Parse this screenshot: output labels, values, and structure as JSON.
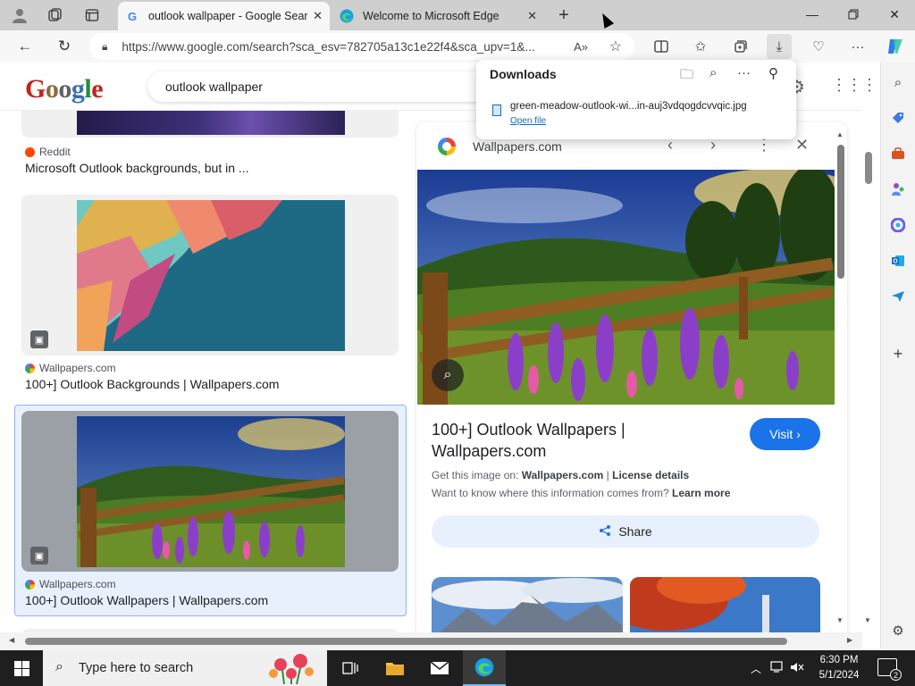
{
  "browser": {
    "tabs": [
      {
        "title": "outlook wallpaper - Google Sear",
        "favicon": "google-g-icon",
        "active": true
      },
      {
        "title": "Welcome to Microsoft Edge",
        "favicon": "edge-icon",
        "active": false
      }
    ],
    "url": "https://www.google.com/search?sca_esv=782705a13c1e22f4&sca_upv=1&...",
    "accent_color": "#0f6cbd"
  },
  "google": {
    "logo_letters": [
      "G",
      "o",
      "o",
      "g",
      "l",
      "e"
    ],
    "search_query": "outlook wallpaper"
  },
  "results": [
    {
      "source": "Reddit",
      "title": "Microsoft Outlook backgrounds, but in ..."
    },
    {
      "source": "Wallpapers.com",
      "title": "100+] Outlook Backgrounds | Wallpapers.com"
    },
    {
      "source": "Wallpapers.com",
      "title": "100+] Outlook Wallpapers | Wallpapers.com"
    }
  ],
  "panel": {
    "site": "Wallpapers.com",
    "title": "100+] Outlook Wallpapers | Wallpapers.com",
    "visit_label": "Visit",
    "get_image_prefix": "Get this image on:",
    "get_image_site": "Wallpapers.com",
    "separator": "|",
    "license": "License details",
    "info_question": "Want to know where this information comes from?",
    "learn_more": "Learn more",
    "share_label": "Share"
  },
  "downloads": {
    "title": "Downloads",
    "filename": "green-meadow-outlook-wi...in-auj3vdqogdcvvqic.jpg",
    "open_file": "Open file"
  },
  "taskbar": {
    "search_placeholder": "Type here to search",
    "time": "6:30 PM",
    "date": "5/1/2024",
    "notification_count": "2"
  }
}
